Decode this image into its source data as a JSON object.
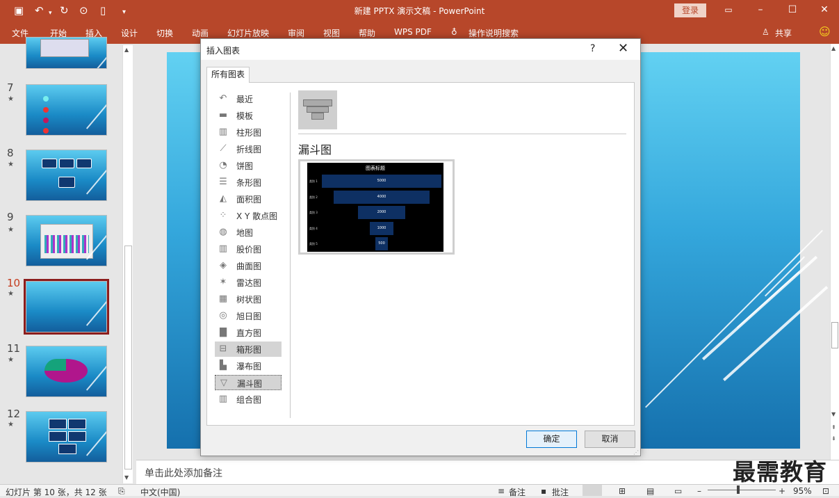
{
  "window": {
    "title": "新建 PPTX 演示文稿  -  PowerPoint",
    "login_label": "登录",
    "share_label": "共享"
  },
  "ribbon": {
    "tabs": [
      "文件",
      "开始",
      "插入",
      "设计",
      "切换",
      "动画",
      "幻灯片放映",
      "审阅",
      "视图",
      "帮助",
      "WPS PDF",
      "操作说明搜索"
    ]
  },
  "slides": {
    "numbers": [
      "7",
      "8",
      "9",
      "10",
      "11",
      "12"
    ],
    "star": "★",
    "selected_index": 10
  },
  "notes": {
    "placeholder": "单击此处添加备注"
  },
  "statusbar": {
    "slide_info": "幻灯片 第 10 张，共 12 张",
    "language": "中文(中国)",
    "notes_label": "备注",
    "comments_label": "批注",
    "zoom": "95%"
  },
  "watermark": "最需教育",
  "dialog": {
    "title": "插入图表",
    "help": "?",
    "tab": "所有图表",
    "categories": [
      {
        "label": "最近",
        "icon": "recent-icon"
      },
      {
        "label": "模板",
        "icon": "folder-icon"
      },
      {
        "label": "柱形图",
        "icon": "column-chart-icon"
      },
      {
        "label": "折线图",
        "icon": "line-chart-icon"
      },
      {
        "label": "饼图",
        "icon": "pie-chart-icon"
      },
      {
        "label": "条形图",
        "icon": "bar-chart-icon"
      },
      {
        "label": "面积图",
        "icon": "area-chart-icon"
      },
      {
        "label": "X Y 散点图",
        "icon": "scatter-chart-icon"
      },
      {
        "label": "地图",
        "icon": "map-chart-icon"
      },
      {
        "label": "股价图",
        "icon": "stock-chart-icon"
      },
      {
        "label": "曲面图",
        "icon": "surface-chart-icon"
      },
      {
        "label": "雷达图",
        "icon": "radar-chart-icon"
      },
      {
        "label": "树状图",
        "icon": "treemap-chart-icon"
      },
      {
        "label": "旭日图",
        "icon": "sunburst-chart-icon"
      },
      {
        "label": "直方图",
        "icon": "histogram-chart-icon"
      },
      {
        "label": "箱形图",
        "icon": "boxplot-chart-icon"
      },
      {
        "label": "瀑布图",
        "icon": "waterfall-chart-icon"
      },
      {
        "label": "漏斗图",
        "icon": "funnel-chart-icon"
      },
      {
        "label": "组合图",
        "icon": "combo-chart-icon"
      }
    ],
    "hovered_category": "箱形图",
    "selected_category": "漏斗图",
    "chart_name": "漏斗图",
    "preview": {
      "title": "图表标题",
      "categories": [
        "类别 1",
        "类别 2",
        "类别 3",
        "类别 4",
        "类别 5"
      ],
      "values": [
        5000,
        4000,
        2000,
        1000,
        500
      ]
    },
    "ok_label": "确定",
    "cancel_label": "取消"
  }
}
